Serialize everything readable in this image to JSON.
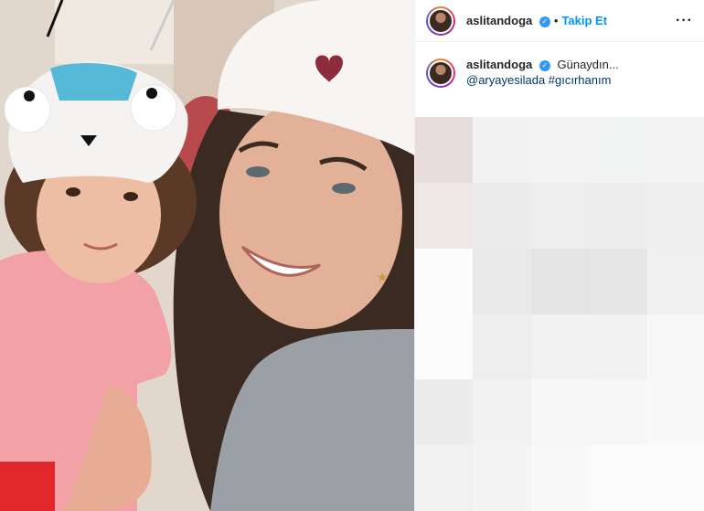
{
  "post": {
    "username": "aslitandoga",
    "verified_symbol": "✓",
    "separator": "•",
    "follow_label": "Takip Et",
    "more_label": "···"
  },
  "caption": {
    "username": "aslitandoga",
    "text": "Günaydın...",
    "tags": "@aryayesilada #gıcırhanım"
  },
  "blur_colors": [
    "#e9dcdc",
    "#f2f2f2",
    "#f3f3f3",
    "#f2f3f3",
    "#f4f4f4",
    "#efe7e6",
    "#ececed",
    "#eeeeee",
    "#ededed",
    "#efefef",
    "#fcfcfc",
    "#e9e9ea",
    "#e4e4e4",
    "#e6e6e6",
    "#f0f0f0",
    "#fbfbfb",
    "#eeeeee",
    "#f1f1f1",
    "#f2f2f2",
    "#f8f8f8",
    "#ececec",
    "#f2f2f2",
    "#f7f7f7",
    "#f6f6f6",
    "#f9f9f9",
    "#f1f1f1",
    "#f4f4f4",
    "#f9f9f9",
    "#fbfbfb",
    "#fcfcfc"
  ]
}
